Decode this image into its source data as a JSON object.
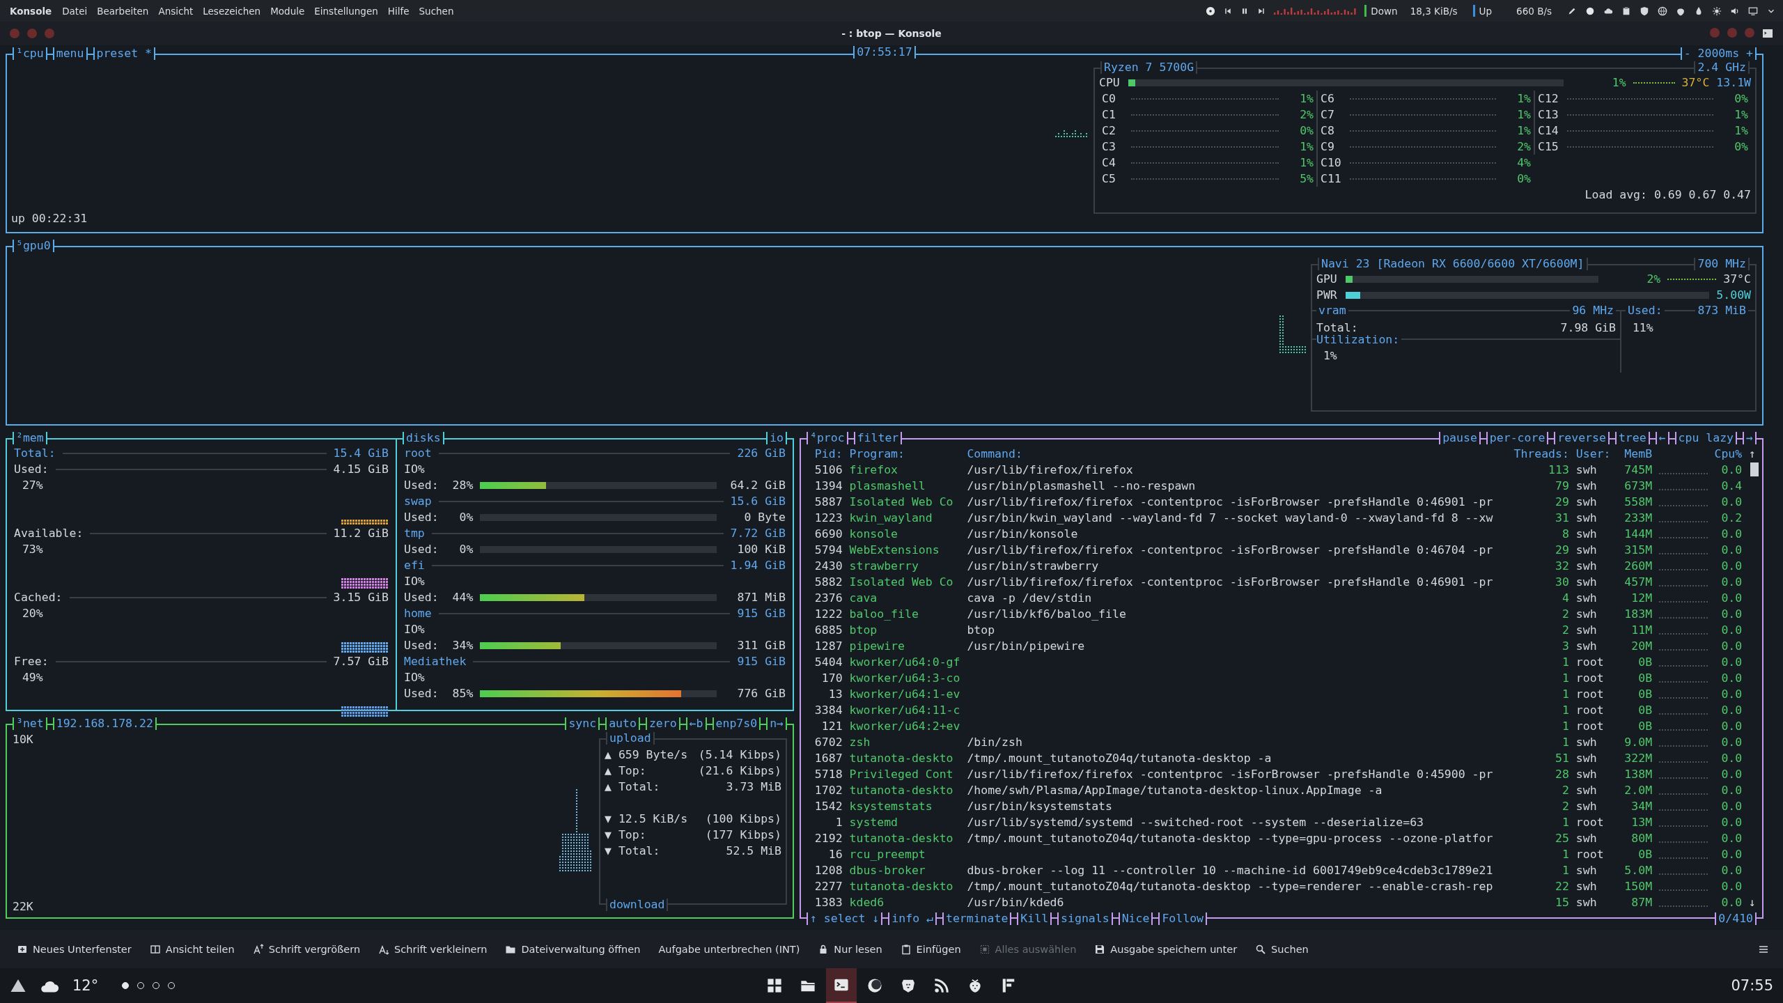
{
  "menubar": {
    "app": "Konsole",
    "menus": [
      "Datei",
      "Bearbeiten",
      "Ansicht",
      "Lesezeichen",
      "Module",
      "Einstellungen",
      "Hilfe",
      "Suchen"
    ],
    "network": {
      "down_label": "Down",
      "down_rate": "18,3 KiB/s",
      "up_label": "Up",
      "up_rate": "660 B/s"
    }
  },
  "window": {
    "title": "- : btop — Konsole"
  },
  "cpu": {
    "titles": [
      "¹cpu",
      "menu",
      "preset *"
    ],
    "clock": "07:55:17",
    "interval": "- 2000ms +",
    "uptime": "up 00:22:31",
    "model": "Ryzen 7 5700G",
    "frequency": "2.4 GHz",
    "total": {
      "label": "CPU",
      "level": 0.01,
      "percent": "1%",
      "temperature": "37°C",
      "power": "13.1W"
    },
    "cores": [
      {
        "name": "C0",
        "percent": "1%"
      },
      {
        "name": "C1",
        "percent": "2%"
      },
      {
        "name": "C2",
        "percent": "0%"
      },
      {
        "name": "C3",
        "percent": "1%"
      },
      {
        "name": "C4",
        "percent": "1%"
      },
      {
        "name": "C5",
        "percent": "5%"
      },
      {
        "name": "C6",
        "percent": "1%"
      },
      {
        "name": "C7",
        "percent": "1%"
      },
      {
        "name": "C8",
        "percent": "1%"
      },
      {
        "name": "C9",
        "percent": "2%"
      },
      {
        "name": "C10",
        "percent": "4%"
      },
      {
        "name": "C11",
        "percent": "0%"
      },
      {
        "name": "C12",
        "percent": "0%"
      },
      {
        "name": "C13",
        "percent": "1%"
      },
      {
        "name": "C14",
        "percent": "1%"
      },
      {
        "name": "C15",
        "percent": "0%"
      }
    ],
    "load_avg": "Load avg: 0.69 0.67 0.47"
  },
  "gpu": {
    "title": "⁵gpu0",
    "name": "Navi 23 [Radeon RX 6600/6600 XT/6600M]",
    "clock": "700 MHz",
    "meters": [
      {
        "kind": "load",
        "label": "GPU",
        "level": 0.02,
        "reading": "2%",
        "temperature": "37°C"
      },
      {
        "kind": "power",
        "label": "PWR",
        "level": 0.04,
        "reading": "5.00W"
      }
    ],
    "vram": {
      "title": "vram",
      "clock": "96 MHz",
      "total_label": "Total:",
      "total": "7.98 GiB",
      "utilization_label": "Utilization:",
      "utilization": "1%",
      "used_label": "Used:",
      "used": "873 MiB",
      "used_percent": "11%"
    }
  },
  "mem": {
    "title": "²mem",
    "items": [
      {
        "label": "Total:",
        "value": "15.4 GiB"
      },
      {
        "label": "Used:",
        "value": "4.15 GiB",
        "percent": "27%",
        "color": "#e0a030"
      },
      {
        "label": "Available:",
        "value": "11.2 GiB",
        "percent": "73%",
        "color": "#d080e0"
      },
      {
        "label": "Cached:",
        "value": "3.15 GiB",
        "percent": "20%",
        "color": "#60a8f0"
      },
      {
        "label": "Free:",
        "value": "7.57 GiB",
        "percent": "49%",
        "color": "#5c9ee8"
      }
    ]
  },
  "disks": {
    "title": "disks",
    "io_toggle": "io",
    "items": [
      {
        "name": "root",
        "size": "226 GiB",
        "io": "IO%",
        "used_label": "Used:",
        "percent": "28%",
        "level": 0.28,
        "used": "64.2 GiB"
      },
      {
        "name": "swap",
        "size": "15.6 GiB",
        "used_label": "Used:",
        "percent": "0%",
        "level": 0,
        "used": "0 Byte"
      },
      {
        "name": "tmp",
        "size": "7.72 GiB",
        "used_label": "Used:",
        "percent": "0%",
        "level": 0,
        "used": "100 KiB"
      },
      {
        "name": "efi",
        "size": "1.94 GiB",
        "io": "IO%",
        "used_label": "Used:",
        "percent": "44%",
        "level": 0.44,
        "used": "871 MiB"
      },
      {
        "name": "home",
        "size": "915 GiB",
        "io": "IO%",
        "used_label": "Used:",
        "percent": "34%",
        "level": 0.34,
        "used": "311 GiB"
      },
      {
        "name": "Mediathek",
        "size": "915 GiB",
        "io": "IO%",
        "used_label": "Used:",
        "percent": "85%",
        "level": 0.85,
        "used": "776 GiB"
      }
    ]
  },
  "net": {
    "titles": [
      "³net",
      "192.168.178.22"
    ],
    "options": [
      "sync",
      "auto",
      "zero",
      "←b",
      "enp7s0",
      "n→"
    ],
    "scale_top": "10K",
    "scale_bottom": "22K",
    "upload": {
      "title": "upload",
      "rows": [
        {
          "arrow": "▲",
          "label": "659 Byte/s",
          "value": "(5.14 Kibps)"
        },
        {
          "arrow": "▲",
          "label": "Top:",
          "value": "(21.6 Kibps)"
        },
        {
          "arrow": "▲",
          "label": "Total:",
          "value": "3.73 MiB"
        }
      ]
    },
    "download": {
      "title": "download",
      "rows": [
        {
          "arrow": "▼",
          "label": "12.5 KiB/s",
          "value": "(100 Kibps)"
        },
        {
          "arrow": "▼",
          "label": "Top:",
          "value": "(177 Kibps)"
        },
        {
          "arrow": "▼",
          "label": "Total:",
          "value": "52.5 MiB"
        }
      ]
    }
  },
  "proc": {
    "titles": [
      "⁴proc",
      "filter"
    ],
    "options": [
      "pause",
      "per-core",
      "reverse",
      "tree",
      "←",
      "cpu lazy",
      "→"
    ],
    "columns": [
      "Pid:",
      "Program:",
      "Command:",
      "Threads:",
      "User:",
      "MemB",
      "Cpu%"
    ],
    "scroll_up": "↑",
    "scroll_down": "↓",
    "rows": [
      {
        "pid": "5106",
        "program": "firefox",
        "command": "/usr/lib/firefox/firefox",
        "threads": "113",
        "user": "swh",
        "mem": "745M",
        "cpu": "0.0"
      },
      {
        "pid": "1394",
        "program": "plasmashell",
        "command": "/usr/bin/plasmashell --no-respawn",
        "threads": "79",
        "user": "swh",
        "mem": "673M",
        "cpu": "0.4"
      },
      {
        "pid": "5887",
        "program": "Isolated Web Co",
        "command": "/usr/lib/firefox/firefox -contentproc -isForBrowser -prefsHandle 0:46901 -pr",
        "threads": "29",
        "user": "swh",
        "mem": "558M",
        "cpu": "0.0"
      },
      {
        "pid": "1223",
        "program": "kwin_wayland",
        "command": "/usr/bin/kwin_wayland --wayland-fd 7 --socket wayland-0 --xwayland-fd 8 --xw",
        "threads": "31",
        "user": "swh",
        "mem": "233M",
        "cpu": "0.2"
      },
      {
        "pid": "6690",
        "program": "konsole",
        "command": "/usr/bin/konsole",
        "threads": "8",
        "user": "swh",
        "mem": "144M",
        "cpu": "0.0"
      },
      {
        "pid": "5794",
        "program": "WebExtensions",
        "command": "/usr/lib/firefox/firefox -contentproc -isForBrowser -prefsHandle 0:46704 -pr",
        "threads": "29",
        "user": "swh",
        "mem": "315M",
        "cpu": "0.0"
      },
      {
        "pid": "2430",
        "program": "strawberry",
        "command": "/usr/bin/strawberry",
        "threads": "32",
        "user": "swh",
        "mem": "260M",
        "cpu": "0.0"
      },
      {
        "pid": "5882",
        "program": "Isolated Web Co",
        "command": "/usr/lib/firefox/firefox -contentproc -isForBrowser -prefsHandle 0:46901 -pr",
        "threads": "30",
        "user": "swh",
        "mem": "457M",
        "cpu": "0.0"
      },
      {
        "pid": "2376",
        "program": "cava",
        "command": "cava -p /dev/stdin",
        "threads": "4",
        "user": "swh",
        "mem": "12M",
        "cpu": "0.0"
      },
      {
        "pid": "1222",
        "program": "baloo_file",
        "command": "/usr/lib/kf6/baloo_file",
        "threads": "2",
        "user": "swh",
        "mem": "183M",
        "cpu": "0.0"
      },
      {
        "pid": "6885",
        "program": "btop",
        "command": "btop",
        "threads": "2",
        "user": "swh",
        "mem": "11M",
        "cpu": "0.0"
      },
      {
        "pid": "1287",
        "program": "pipewire",
        "command": "/usr/bin/pipewire",
        "threads": "3",
        "user": "swh",
        "mem": "20M",
        "cpu": "0.0"
      },
      {
        "pid": "5404",
        "program": "kworker/u64:0-gf",
        "threads": "1",
        "user": "root",
        "mem": "0B",
        "cpu": "0.0"
      },
      {
        "pid": "170",
        "program": "kworker/u64:3-co",
        "threads": "1",
        "user": "root",
        "mem": "0B",
        "cpu": "0.0"
      },
      {
        "pid": "13",
        "program": "kworker/u64:1-ev",
        "threads": "1",
        "user": "root",
        "mem": "0B",
        "cpu": "0.0"
      },
      {
        "pid": "3384",
        "program": "kworker/u64:11-c",
        "threads": "1",
        "user": "root",
        "mem": "0B",
        "cpu": "0.0"
      },
      {
        "pid": "121",
        "program": "kworker/u64:2+ev",
        "threads": "1",
        "user": "root",
        "mem": "0B",
        "cpu": "0.0"
      },
      {
        "pid": "6702",
        "program": "zsh",
        "command": "/bin/zsh",
        "threads": "1",
        "user": "swh",
        "mem": "9.0M",
        "cpu": "0.0"
      },
      {
        "pid": "1687",
        "program": "tutanota-deskto",
        "command": "/tmp/.mount_tutanotoZ04q/tutanota-desktop -a",
        "threads": "51",
        "user": "swh",
        "mem": "322M",
        "cpu": "0.0"
      },
      {
        "pid": "5718",
        "program": "Privileged Cont",
        "command": "/usr/lib/firefox/firefox -contentproc -isForBrowser -prefsHandle 0:45900 -pr",
        "threads": "28",
        "user": "swh",
        "mem": "138M",
        "cpu": "0.0"
      },
      {
        "pid": "1702",
        "program": "tutanota-deskto",
        "command": "/home/swh/Plasma/AppImage/tutanota-desktop-linux.AppImage -a",
        "threads": "2",
        "user": "swh",
        "mem": "2.0M",
        "cpu": "0.0"
      },
      {
        "pid": "1542",
        "program": "ksystemstats",
        "command": "/usr/bin/ksystemstats",
        "threads": "2",
        "user": "swh",
        "mem": "34M",
        "cpu": "0.0"
      },
      {
        "pid": "1",
        "program": "systemd",
        "command": "/usr/lib/systemd/systemd --switched-root --system --deserialize=63",
        "threads": "1",
        "user": "root",
        "mem": "13M",
        "cpu": "0.0"
      },
      {
        "pid": "2192",
        "program": "tutanota-deskto",
        "command": "/tmp/.mount_tutanotoZ04q/tutanota-desktop --type=gpu-process --ozone-platfor",
        "threads": "25",
        "user": "swh",
        "mem": "80M",
        "cpu": "0.0"
      },
      {
        "pid": "16",
        "program": "rcu_preempt",
        "threads": "1",
        "user": "root",
        "mem": "0B",
        "cpu": "0.0"
      },
      {
        "pid": "1208",
        "program": "dbus-broker",
        "command": "dbus-broker --log 11 --controller 10 --machine-id 6001749eb9ce4cdeb3c1789e21",
        "threads": "1",
        "user": "swh",
        "mem": "5.0M",
        "cpu": "0.0"
      },
      {
        "pid": "2277",
        "program": "tutanota-deskto",
        "command": "/tmp/.mount_tutanotoZ04q/tutanota-desktop --type=renderer --enable-crash-rep",
        "threads": "22",
        "user": "swh",
        "mem": "150M",
        "cpu": "0.0"
      },
      {
        "pid": "1383",
        "program": "kded6",
        "command": "/usr/bin/kded6",
        "threads": "15",
        "user": "swh",
        "mem": "87M",
        "cpu": "0.0"
      }
    ],
    "footer": [
      "↑ select ↓",
      "info ↵",
      "terminate",
      "Kill",
      "signals",
      "Nice",
      "Follow"
    ],
    "count": "0/410"
  },
  "toolbar": [
    {
      "label": "Neues Unterfenster",
      "disabled": false
    },
    {
      "label": "Ansicht teilen",
      "disabled": false
    },
    {
      "label": "Schrift vergrößern",
      "disabled": false
    },
    {
      "label": "Schrift verkleinern",
      "disabled": false
    },
    {
      "label": "Dateiverwaltung öffnen",
      "disabled": false
    },
    {
      "label": "Aufgabe unterbrechen (INT)",
      "disabled": false
    },
    {
      "label": "Nur lesen",
      "disabled": false
    },
    {
      "label": "Einfügen",
      "disabled": false
    },
    {
      "label": "Alles auswählen",
      "disabled": true
    },
    {
      "label": "Ausgabe speichern unter",
      "disabled": false
    },
    {
      "label": "Suchen",
      "disabled": false
    }
  ],
  "taskbar": {
    "temperature": "12°",
    "desktops": [
      {
        "selected": true
      },
      {
        "selected": false
      },
      {
        "selected": false
      },
      {
        "selected": false
      }
    ],
    "apps": [
      {
        "selected": false
      },
      {
        "selected": false
      },
      {
        "selected": true
      },
      {
        "selected": false
      },
      {
        "selected": false
      },
      {
        "selected": false
      },
      {
        "selected": false
      },
      {
        "selected": false
      }
    ],
    "clock": "07:55"
  }
}
